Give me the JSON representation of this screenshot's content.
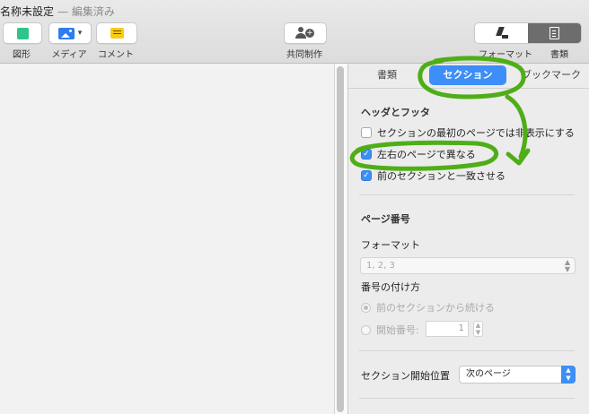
{
  "window": {
    "title": "名称未設定",
    "subtitle": "— 編集済み"
  },
  "toolbar": {
    "shape_label": "図形",
    "media_label": "メディア",
    "comment_label": "コメント",
    "collab_label": "共同制作",
    "format_label": "フォーマット",
    "document_label": "書類"
  },
  "sidebar": {
    "tabs": [
      {
        "label": "書類",
        "active": false
      },
      {
        "label": "セクション",
        "active": true
      },
      {
        "label": "ブックマーク",
        "active": false
      }
    ],
    "header_footer": {
      "title": "ヘッダとフッタ",
      "options": [
        {
          "label": "セクションの最初のページでは非表示にする",
          "checked": false
        },
        {
          "label": "左右のページで異なる",
          "checked": true
        },
        {
          "label": "前のセクションと一致させる",
          "checked": true
        }
      ]
    },
    "page_number": {
      "title": "ページ番号",
      "format_label": "フォーマット",
      "format_value": "1, 2, 3",
      "numbering_label": "番号の付け方",
      "continue_label": "前のセクションから続ける",
      "start_label": "開始番号:",
      "start_value": "1"
    },
    "section_start": {
      "label": "セクション開始位置",
      "value": "次のページ"
    }
  },
  "colors": {
    "accent": "#3d8ef6",
    "annotation": "#4fae18"
  }
}
